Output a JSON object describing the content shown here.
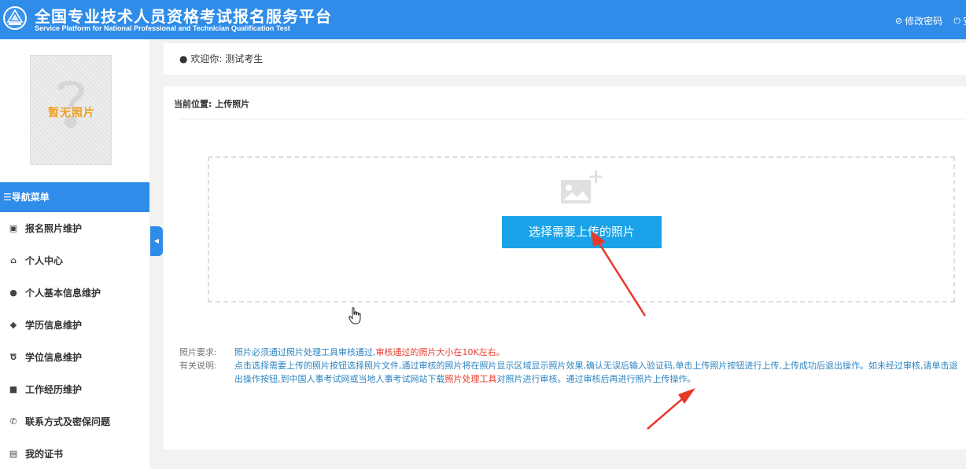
{
  "header": {
    "title_cn": "全国专业技术人员资格考试报名服务平台",
    "title_en": "Service Platform for National Professional and Technician Qualification Test",
    "actions": [
      {
        "icon": "edit-icon",
        "label": "修改密码"
      },
      {
        "icon": "power-icon",
        "label": "安"
      }
    ]
  },
  "sidebar": {
    "photo_placeholder": "暂无照片",
    "nav_title": "☰导航菜单",
    "items": [
      {
        "icon": "image-icon",
        "label": "报名照片维护"
      },
      {
        "icon": "home-icon",
        "label": "个人中心"
      },
      {
        "icon": "user-icon",
        "label": "个人基本信息维护"
      },
      {
        "icon": "graduation-cap-icon",
        "label": "学历信息维护"
      },
      {
        "icon": "degree-icon",
        "label": "学位信息维护"
      },
      {
        "icon": "briefcase-icon",
        "label": "工作经历维护"
      },
      {
        "icon": "phone-icon",
        "label": "联系方式及密保问题"
      },
      {
        "icon": "certificate-icon",
        "label": "我的证书"
      }
    ]
  },
  "welcome": {
    "label": "欢迎你:",
    "name": "测试考生"
  },
  "main": {
    "breadcrumb": "当前位置: 上传照片",
    "upload_button": "选择需要上传的照片",
    "requirements_label": "照片要求:",
    "requirements_text": "照片必须通过照片处理工具审核通过,",
    "requirements_highlight": "审核通过的照片大小在10K左右。",
    "notes_label": "有关说明:",
    "notes_text_1": "点击选择需要上传的照片按钮选择照片文件,通过审核的照片将在照片显示区域显示照片效果,确认无误后输入验证码,单击上传照片按钮进行上传,上传成功后退出操作。如未经过审核,请单击退出操作按钮,到中国人事考试网或当地人事考试网站下载",
    "notes_highlight": "照片处理工具",
    "notes_text_2": "对照片进行审核。通过审核后再进行照片上传操作。"
  },
  "colors": {
    "primary": "#2f8ce8",
    "button": "#1aa3e8",
    "highlight": "#e83b2a",
    "link_text": "#2c84c0",
    "annotation": "#e8382a"
  }
}
